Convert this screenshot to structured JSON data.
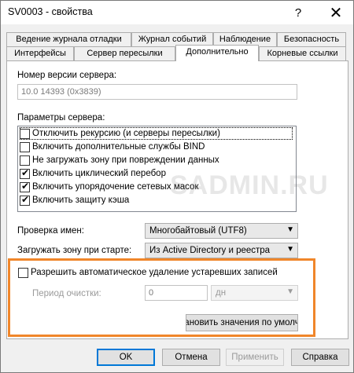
{
  "window": {
    "title": "SV0003 - свойства",
    "help_label": "?",
    "close_label": "✕"
  },
  "tabs": {
    "row1": [
      "Ведение журнала отладки",
      "Журнал событий",
      "Наблюдение",
      "Безопасность"
    ],
    "row2": [
      "Интерфейсы",
      "Сервер пересылки",
      "Дополнительно",
      "Корневые ссылки"
    ],
    "active": "Дополнительно"
  },
  "server_version": {
    "label": "Номер версии сервера:",
    "value": "10.0 14393 (0x3839)"
  },
  "server_options": {
    "label": "Параметры сервера:",
    "items": [
      {
        "label": "Отключить рекурсию (и серверы пересылки)",
        "checked": false
      },
      {
        "label": "Включить дополнительные службы BIND",
        "checked": false
      },
      {
        "label": "Не загружать зону при повреждении данных",
        "checked": false
      },
      {
        "label": "Включить циклический перебор",
        "checked": true
      },
      {
        "label": "Включить упорядочение сетевых масок",
        "checked": true
      },
      {
        "label": "Включить защиту кэша",
        "checked": true
      }
    ]
  },
  "name_check": {
    "label": "Проверка имен:",
    "value": "Многобайтовый (UTF8)"
  },
  "load_zone": {
    "label": "Загружать зону при старте:",
    "value": "Из Active Directory и реестра"
  },
  "scavenging": {
    "checkbox_label": "Разрешить автоматическое удаление устаревших записей",
    "checked": false,
    "period_label": "Период очистки:",
    "period_value": "0",
    "unit_value": "дн",
    "reset_button": "ановить значения по умолч"
  },
  "watermark": "SADMIN.RU",
  "footer": {
    "ok": "OK",
    "cancel": "Отмена",
    "apply": "Применить",
    "help": "Справка"
  },
  "colors": {
    "highlight": "#f0862a",
    "default_button_border": "#0078d7"
  }
}
